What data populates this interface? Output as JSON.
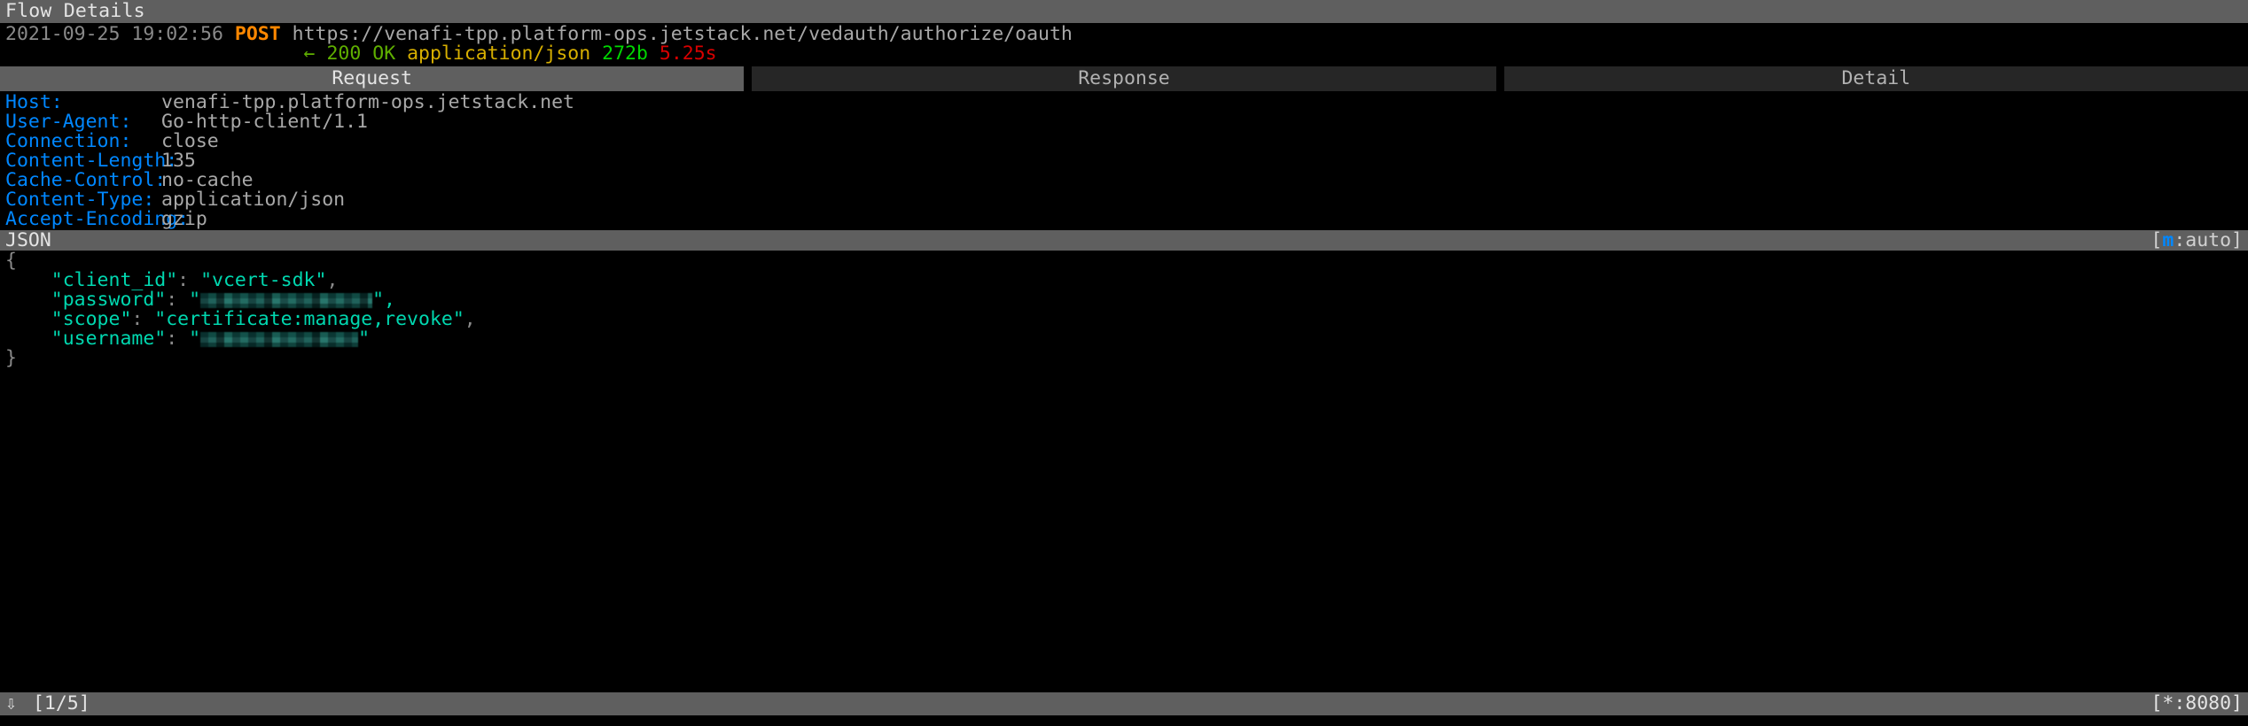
{
  "window": {
    "title": "Flow Details"
  },
  "flow": {
    "timestamp": "2021-09-25 19:02:56",
    "method": "POST",
    "url": "https://venafi-tpp.platform-ops.jetstack.net/vedauth/authorize/oauth",
    "response_arrow": "←",
    "status_code": "200",
    "status_text": "OK",
    "content_type": "application/json",
    "size": "272b",
    "duration": "5.25s"
  },
  "tabs": [
    {
      "label": "Request",
      "active": true
    },
    {
      "label": "Response",
      "active": false
    },
    {
      "label": "Detail",
      "active": false
    }
  ],
  "request_headers": [
    {
      "name": "Host:",
      "value": "venafi-tpp.platform-ops.jetstack.net"
    },
    {
      "name": "User-Agent:",
      "value": "Go-http-client/1.1"
    },
    {
      "name": "Connection:",
      "value": "close"
    },
    {
      "name": "Content-Length:",
      "value": "135"
    },
    {
      "name": "Cache-Control:",
      "value": "no-cache"
    },
    {
      "name": "Content-Type:",
      "value": "application/json"
    },
    {
      "name": "Accept-Encoding:",
      "value": "gzip"
    }
  ],
  "content_view": {
    "name": "JSON",
    "mode_open": "[",
    "mode_key": "m",
    "mode_sep": ":",
    "mode_value": "auto",
    "mode_close": "]"
  },
  "body": {
    "open_brace": "{",
    "close_brace": "}",
    "lines": [
      {
        "indent": "    ",
        "key": "\"client_id\"",
        "sep": ": ",
        "value": "\"vcert-sdk\"",
        "trailing": ",",
        "redacted": false
      },
      {
        "indent": "    ",
        "key": "\"password\"",
        "sep": ": ",
        "value": "\"",
        "trailing": "\",",
        "redacted": true,
        "redact_class": "pw"
      },
      {
        "indent": "    ",
        "key": "\"scope\"",
        "sep": ": ",
        "value": "\"certificate:manage,revoke\"",
        "trailing": ",",
        "redacted": false
      },
      {
        "indent": "    ",
        "key": "\"username\"",
        "sep": ": ",
        "value": "\"",
        "trailing": "\"",
        "redacted": true,
        "redact_class": "un"
      }
    ]
  },
  "status_bar": {
    "arrow_icon": "⇩",
    "flow_position": "[1/5]",
    "listen_addr": "[*:8080]"
  },
  "colors": {
    "bar_bg": "#5f5f5f",
    "tab_inactive_bg": "#262626",
    "method": "#ff8700",
    "status_ok": "#5faf00",
    "content_type": "#d7af00",
    "size": "#00d700",
    "duration": "#d70000",
    "header_name": "#0087ff",
    "json_string": "#00d7af"
  }
}
